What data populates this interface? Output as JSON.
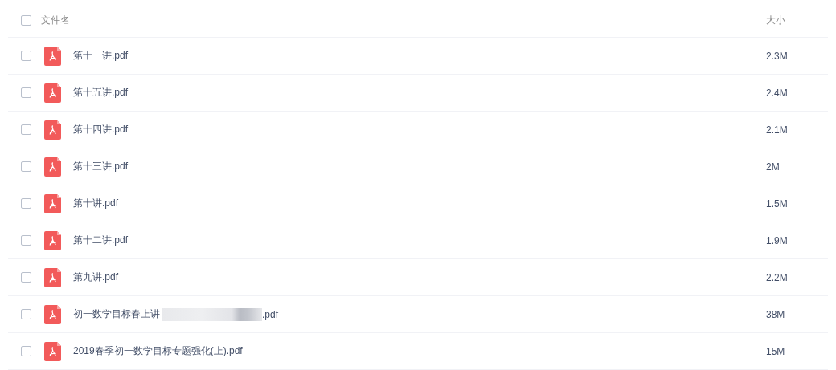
{
  "header": {
    "checked": false,
    "name_label": "文件名",
    "size_label": "大小"
  },
  "files": [
    {
      "kind": "plain",
      "checked": false,
      "name": "第十一讲.pdf",
      "size": "2.3M"
    },
    {
      "kind": "plain",
      "checked": false,
      "name": "第十五讲.pdf",
      "size": "2.4M"
    },
    {
      "kind": "plain",
      "checked": false,
      "name": "第十四讲.pdf",
      "size": "2.1M"
    },
    {
      "kind": "plain",
      "checked": false,
      "name": "第十三讲.pdf",
      "size": "2M"
    },
    {
      "kind": "plain",
      "checked": false,
      "name": "第十讲.pdf",
      "size": "1.5M"
    },
    {
      "kind": "plain",
      "checked": false,
      "name": "第十二讲.pdf",
      "size": "1.9M"
    },
    {
      "kind": "plain",
      "checked": false,
      "name": "第九讲.pdf",
      "size": "2.2M"
    },
    {
      "kind": "redacted",
      "checked": false,
      "name": "初一数学目标春上讲",
      "name_end": ".pdf",
      "size": "38M"
    },
    {
      "kind": "plain",
      "checked": false,
      "name": "2019春季初一数学目标专题强化(上).pdf",
      "size": "15M"
    }
  ]
}
